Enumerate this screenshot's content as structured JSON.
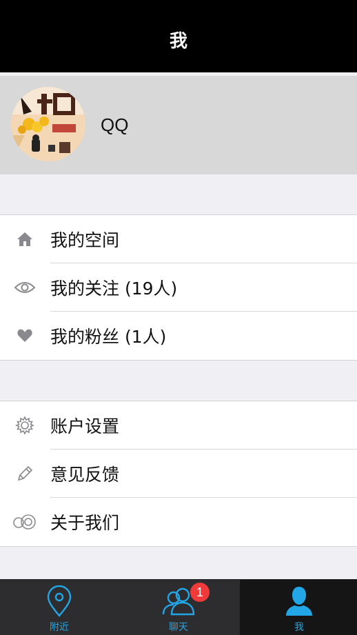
{
  "nav": {
    "title": "我"
  },
  "profile": {
    "name": "QQ"
  },
  "menu_group_1": [
    {
      "label": "我的空间",
      "icon": "home-icon"
    },
    {
      "label": "我的关注 (19人)",
      "icon": "eye-icon"
    },
    {
      "label": "我的粉丝 (1人)",
      "icon": "heart-icon"
    }
  ],
  "menu_group_2": [
    {
      "label": "账户设置",
      "icon": "gear-icon"
    },
    {
      "label": "意见反馈",
      "icon": "pencil-icon"
    },
    {
      "label": "关于我们",
      "icon": "rings-icon"
    }
  ],
  "tab_bar": {
    "tabs": [
      {
        "label": "附近",
        "icon": "location-pin-icon"
      },
      {
        "label": "聊天",
        "icon": "people-icon",
        "badge": "1"
      },
      {
        "label": "我",
        "icon": "person-icon",
        "active": true
      }
    ]
  },
  "colors": {
    "accent": "#23a6e6",
    "badge": "#f03a3a",
    "nav_background": "#000000",
    "tab_background": "#2d2d2f"
  }
}
